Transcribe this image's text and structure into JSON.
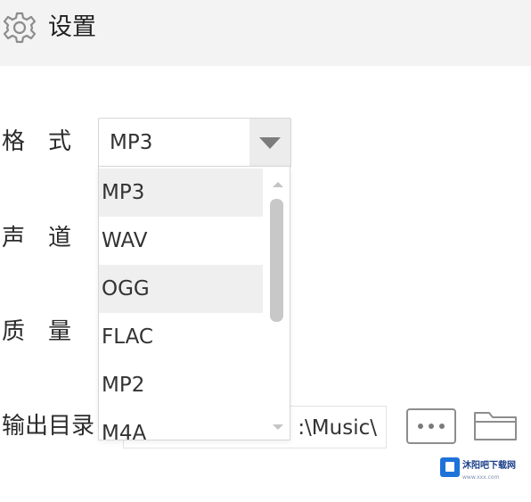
{
  "header": {
    "icon": "gear-icon",
    "title": "设置"
  },
  "form": {
    "format_label": "格式",
    "channel_label": "声道",
    "quality_label": "质量",
    "output_label": "输出目录"
  },
  "format_select": {
    "value": "MP3",
    "options": [
      "MP3",
      "WAV",
      "OGG",
      "FLAC",
      "MP2",
      "M4A"
    ],
    "highlighted": [
      "MP3",
      "OGG"
    ]
  },
  "output": {
    "path_visible": ":\\Music\\",
    "browse_icon": "ellipsis-icon",
    "folder_icon": "folder-icon"
  },
  "watermark": {
    "text": "沐阳吧下载网",
    "sub": "www.xxx.com"
  },
  "colors": {
    "header_bg": "#f3f3f3",
    "highlight_bg": "#efefef",
    "border": "#d6d6d6",
    "watermark_blue": "#1e73d9"
  }
}
